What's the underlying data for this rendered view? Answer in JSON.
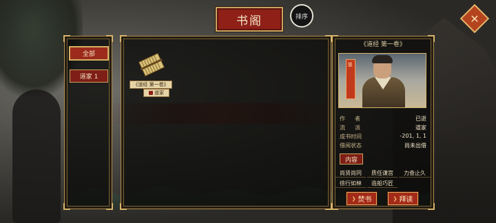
{
  "header": {
    "title": "书阁",
    "sort_label": "排序",
    "close_glyph": "✕"
  },
  "filters": [
    {
      "label": "全部",
      "active": true
    },
    {
      "label": "道家 1",
      "active": false
    }
  ],
  "books": [
    {
      "title": "《道经 第一卷》",
      "school": "道家",
      "icon": "scroll-bundle-icon"
    }
  ],
  "detail": {
    "book_name": "《道经 第一卷》",
    "portrait_icon": "sage-portrait",
    "banner_text": "道",
    "info": [
      {
        "key": "作　者",
        "value": "已逝"
      },
      {
        "key": "流　派",
        "value": "道家"
      },
      {
        "key": "成书时间",
        "value": "-201, 1, 1"
      },
      {
        "key": "借阅状态",
        "value": "尚未出借"
      }
    ],
    "content_tab": "内容",
    "skills": [
      "尚贤尚同",
      "质任谦宫",
      "力奋止久",
      "徐行如林",
      "造船巧匠"
    ],
    "actions": {
      "burn": "焚书",
      "read": "拜读"
    }
  },
  "colors": {
    "accent_red": "#8e2018",
    "gold_border": "#c9a560",
    "panel_bg": "#0a0a09"
  }
}
